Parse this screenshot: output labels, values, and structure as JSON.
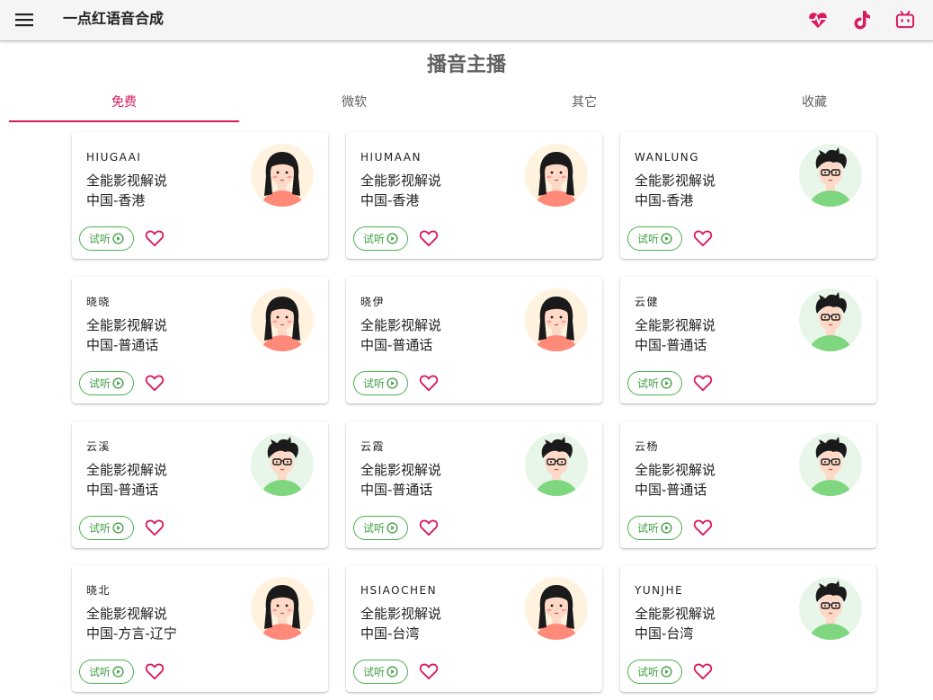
{
  "app": {
    "title": "一点红语音合成"
  },
  "page": {
    "title": "播音主播"
  },
  "tabs": [
    {
      "label": "免费",
      "active": true
    },
    {
      "label": "微软",
      "active": false
    },
    {
      "label": "其它",
      "active": false
    },
    {
      "label": "收藏",
      "active": false
    }
  ],
  "colors": {
    "accent": "#d81b60",
    "try_button": "#43a047",
    "female_avatar_bg": "#fff3e0",
    "male_avatar_bg": "#e8f5e9"
  },
  "icons": {
    "menu": "menu-icon",
    "heart_pulse": "heart-pulse-icon",
    "tiktok": "tiktok-icon",
    "bilibili": "bilibili-icon",
    "play": "play-circle-icon",
    "favorite": "heart-outline-icon"
  },
  "try_label": "试听",
  "voices": [
    {
      "name": "HIUGAAI",
      "category": "全能影视解说",
      "region": "中国-香港",
      "gender": "female"
    },
    {
      "name": "HIUMAAN",
      "category": "全能影视解说",
      "region": "中国-香港",
      "gender": "female"
    },
    {
      "name": "WANLUNG",
      "category": "全能影视解说",
      "region": "中国-香港",
      "gender": "male"
    },
    {
      "name": "晓晓",
      "category": "全能影视解说",
      "region": "中国-普通话",
      "gender": "female"
    },
    {
      "name": "晓伊",
      "category": "全能影视解说",
      "region": "中国-普通话",
      "gender": "female"
    },
    {
      "name": "云健",
      "category": "全能影视解说",
      "region": "中国-普通话",
      "gender": "male"
    },
    {
      "name": "云溪",
      "category": "全能影视解说",
      "region": "中国-普通话",
      "gender": "male"
    },
    {
      "name": "云霞",
      "category": "全能影视解说",
      "region": "中国-普通话",
      "gender": "male"
    },
    {
      "name": "云杨",
      "category": "全能影视解说",
      "region": "中国-普通话",
      "gender": "male"
    },
    {
      "name": "晓北",
      "category": "全能影视解说",
      "region": "中国-方言-辽宁",
      "gender": "female"
    },
    {
      "name": "HSIAOCHEN",
      "category": "全能影视解说",
      "region": "中国-台湾",
      "gender": "female"
    },
    {
      "name": "YUNJHE",
      "category": "全能影视解说",
      "region": "中国-台湾",
      "gender": "male"
    }
  ]
}
